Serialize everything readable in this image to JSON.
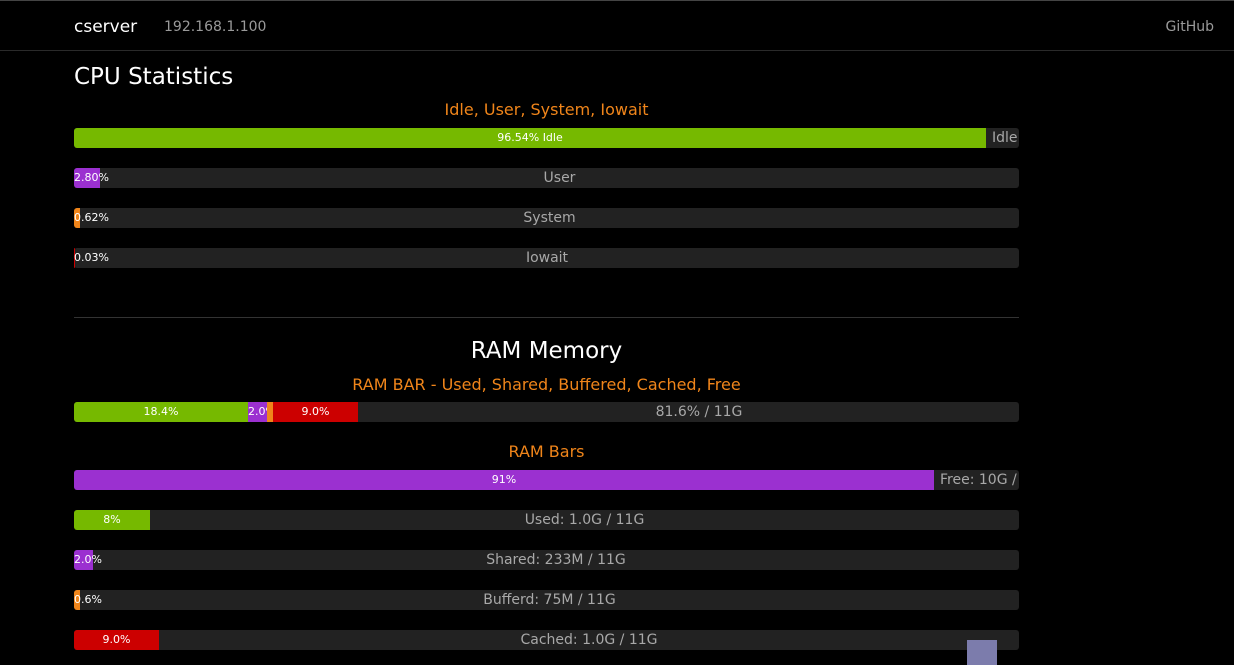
{
  "header": {
    "brand": "cserver",
    "ip": "192.168.1.100",
    "github": "GitHub"
  },
  "cpu": {
    "title": "CPU Statistics",
    "subtitle": "Idle, User, System, Iowait",
    "bars": [
      {
        "value_text": "96.54% Idle",
        "label": "Idle",
        "percent": 96.54,
        "color": "#76b900"
      },
      {
        "value_text": "2.80%",
        "label": "User",
        "percent": 2.8,
        "color": "#9b30d0"
      },
      {
        "value_text": "0.62%",
        "label": "System",
        "percent": 0.62,
        "color": "#f0851a"
      },
      {
        "value_text": "0.03%",
        "label": "Iowait",
        "percent": 0.03,
        "color": "#cc0000"
      }
    ]
  },
  "ram": {
    "title": "RAM Memory",
    "stack_subtitle": "RAM BAR - Used, Shared, Buffered, Cached, Free",
    "stack": {
      "segments": [
        {
          "text": "18.4%",
          "percent": 18.4,
          "color": "#76b900"
        },
        {
          "text": "2.0%",
          "percent": 2.0,
          "color": "#9b30d0"
        },
        {
          "text": "",
          "percent": 0.6,
          "color": "#f0851a"
        },
        {
          "text": "9.0%",
          "percent": 9.0,
          "color": "#cc0000"
        }
      ],
      "free_text": "81.6% / 11G"
    },
    "bars_subtitle": "RAM Bars",
    "bars": [
      {
        "value_text": "91%",
        "label": "Free: 10G /",
        "percent": 91,
        "color": "#9b30d0"
      },
      {
        "value_text": "8%",
        "label": "Used: 1.0G / 11G",
        "percent": 8,
        "color": "#76b900"
      },
      {
        "value_text": "2.0%",
        "label": "Shared: 233M / 11G",
        "percent": 2.0,
        "color": "#9b30d0"
      },
      {
        "value_text": "0.6%",
        "label": "Bufferd: 75M / 11G",
        "percent": 0.6,
        "color": "#f0851a"
      },
      {
        "value_text": "9.0%",
        "label": "Cached: 1.0G / 11G",
        "percent": 9.0,
        "color": "#cc0000"
      }
    ]
  }
}
